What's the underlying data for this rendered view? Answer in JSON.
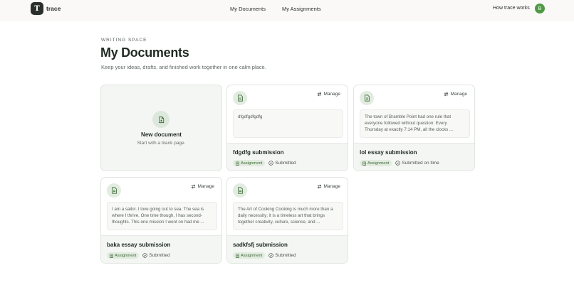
{
  "header": {
    "logo_letter": "T",
    "brand": "trace",
    "nav": [
      "My Documents",
      "My Assignments"
    ],
    "how_link": "How trace works",
    "avatar_initial": "B"
  },
  "page": {
    "eyebrow": "WRITING SPACE",
    "title": "My Documents",
    "subtitle": "Keep your ideas, drafts, and finished work together in one calm place."
  },
  "new_card": {
    "title": "New document",
    "subtitle": "Start with a blank page."
  },
  "manage_label": "Manage",
  "assignment_label": "Assignment",
  "documents": [
    {
      "preview": "dfgdfgdfgdfg",
      "title": "fdgdfg submission",
      "status": "Submitted"
    },
    {
      "preview": "The town of Bramble Point had one rule that everyone followed without question: Every Thursday at exactly 7:14 PM, all the clocks ...",
      "title": "lol essay submission",
      "status": "Submitted on time"
    },
    {
      "preview": "I am a sailor. I love going out to sea. The sea is where I thrive. One time though, I has second-thoughts. This one mission I went on had me ...",
      "title": "baka essay submission",
      "status": "Submitted"
    },
    {
      "preview": "The Art of Cooking Cooking is much more than a daily necessity; it is a timeless art that brings together creativity, culture, science, and ...",
      "title": "sadkfsfj submission",
      "status": "Submitted"
    }
  ]
}
